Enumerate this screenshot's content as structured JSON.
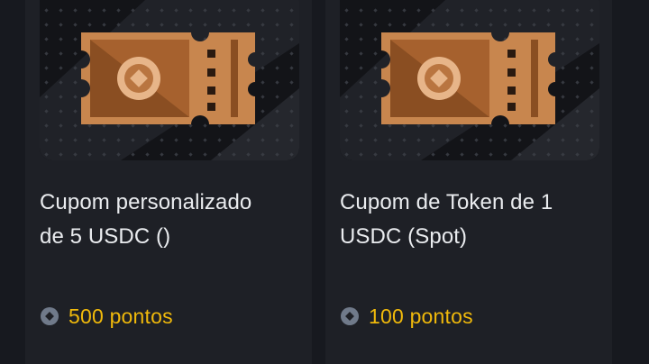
{
  "rewards": [
    {
      "title_line1": "Cupom personalizado",
      "title_line2": "de 5 USDC ()",
      "points_label": "500 pontos",
      "image_icon": "coupon-ticket-icon",
      "points_icon": "points-coin-icon"
    },
    {
      "title_line1": "Cupom de Token de 1",
      "title_line2": "USDC (Spot)",
      "points_label": "100 pontos",
      "image_icon": "coupon-ticket-icon",
      "points_icon": "points-coin-icon"
    }
  ],
  "colors": {
    "background": "#17191f",
    "card": "#1e2026",
    "title_text": "#eaecef",
    "points_text": "#f0b90b",
    "ticket_bronze": "#c8864e"
  }
}
